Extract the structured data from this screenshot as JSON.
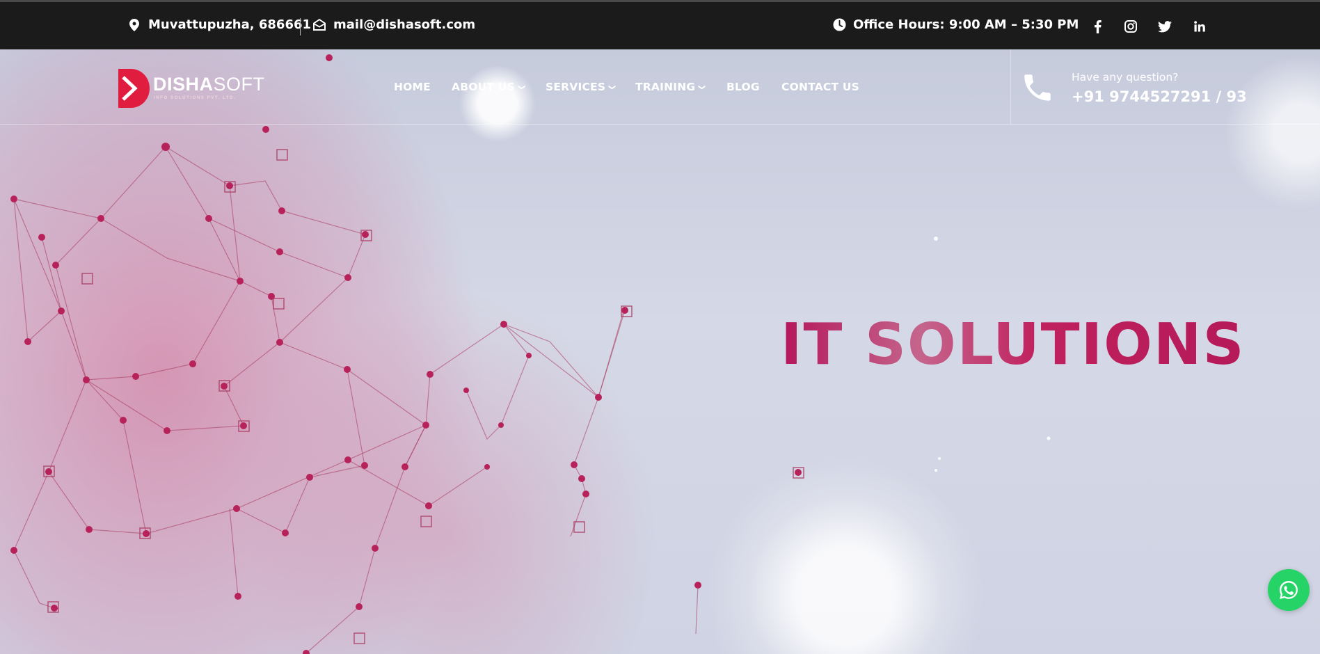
{
  "topbar": {
    "location": "Muvattupuzha, 686661",
    "email": "mail@dishasoft.com",
    "office_hours": "Office Hours: 9:00 AM – 5:30 PM",
    "social": [
      "facebook-icon",
      "instagram-icon",
      "twitter-icon",
      "linkedin-icon"
    ]
  },
  "logo": {
    "name_bold": "DISHA",
    "name_light": "SOFT",
    "tagline": "INFO SOLUTIONS PVT. LTD."
  },
  "nav": {
    "items": [
      {
        "label": "HOME",
        "has_dropdown": false
      },
      {
        "label": "ABOUT US",
        "has_dropdown": true
      },
      {
        "label": "SERVICES",
        "has_dropdown": true
      },
      {
        "label": "TRAINING",
        "has_dropdown": true
      },
      {
        "label": "BLOG",
        "has_dropdown": false
      },
      {
        "label": "CONTACT US",
        "has_dropdown": false
      }
    ]
  },
  "contact": {
    "question": "Have any question?",
    "phone": "+91 9744527291 / 93"
  },
  "hero": {
    "title": "IT SOLUTIONS"
  },
  "colors": {
    "topbar_bg": "#1b1b1b",
    "accent": "#b4165a",
    "logo_red": "#e11d3f",
    "whatsapp": "#25d366"
  }
}
